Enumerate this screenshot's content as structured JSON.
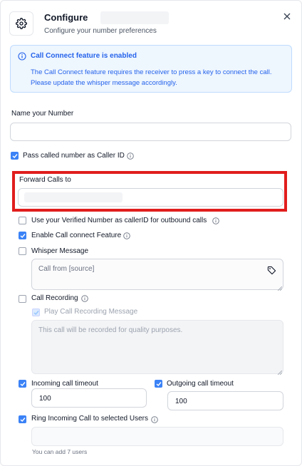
{
  "header": {
    "title": "Configure",
    "subtitle": "Configure your number preferences"
  },
  "notice": {
    "title": "Call Connect feature is enabled",
    "body": "The Call Connect feature requires the receiver to press a key to connect the call. Please update the whisper message accordingly."
  },
  "name_field": {
    "label": "Name your Number",
    "value": ""
  },
  "options": {
    "pass_called_number": {
      "label": "Pass called number as Caller ID",
      "checked": true
    },
    "forward_calls_label": "Forward Calls to",
    "use_verified_number": {
      "label": "Use your Verified Number as callerID for outbound calls",
      "checked": false
    },
    "enable_call_connect": {
      "label": "Enable Call connect Feature",
      "checked": true
    },
    "whisper_message": {
      "label": "Whisper Message",
      "checked": false,
      "placeholder": "Call from [source]"
    },
    "call_recording": {
      "label": "Call Recording",
      "checked": false
    },
    "play_recording_message": {
      "label": "Play Call Recording Message",
      "checked": true,
      "disabled": true,
      "placeholder": "This call will be recorded for quality purposes."
    },
    "incoming_timeout": {
      "label": "Incoming call timeout",
      "checked": true,
      "value": "100"
    },
    "outgoing_timeout": {
      "label": "Outgoing call timeout",
      "checked": true,
      "value": "100"
    },
    "ring_incoming": {
      "label": "Ring Incoming Call to selected Users",
      "checked": true,
      "hint": "You can add 7 users"
    }
  },
  "colors": {
    "accent": "#3b82f6",
    "notice_bg": "#eef6fe",
    "notice_text": "#2563eb",
    "highlight": "#e11d1d"
  }
}
